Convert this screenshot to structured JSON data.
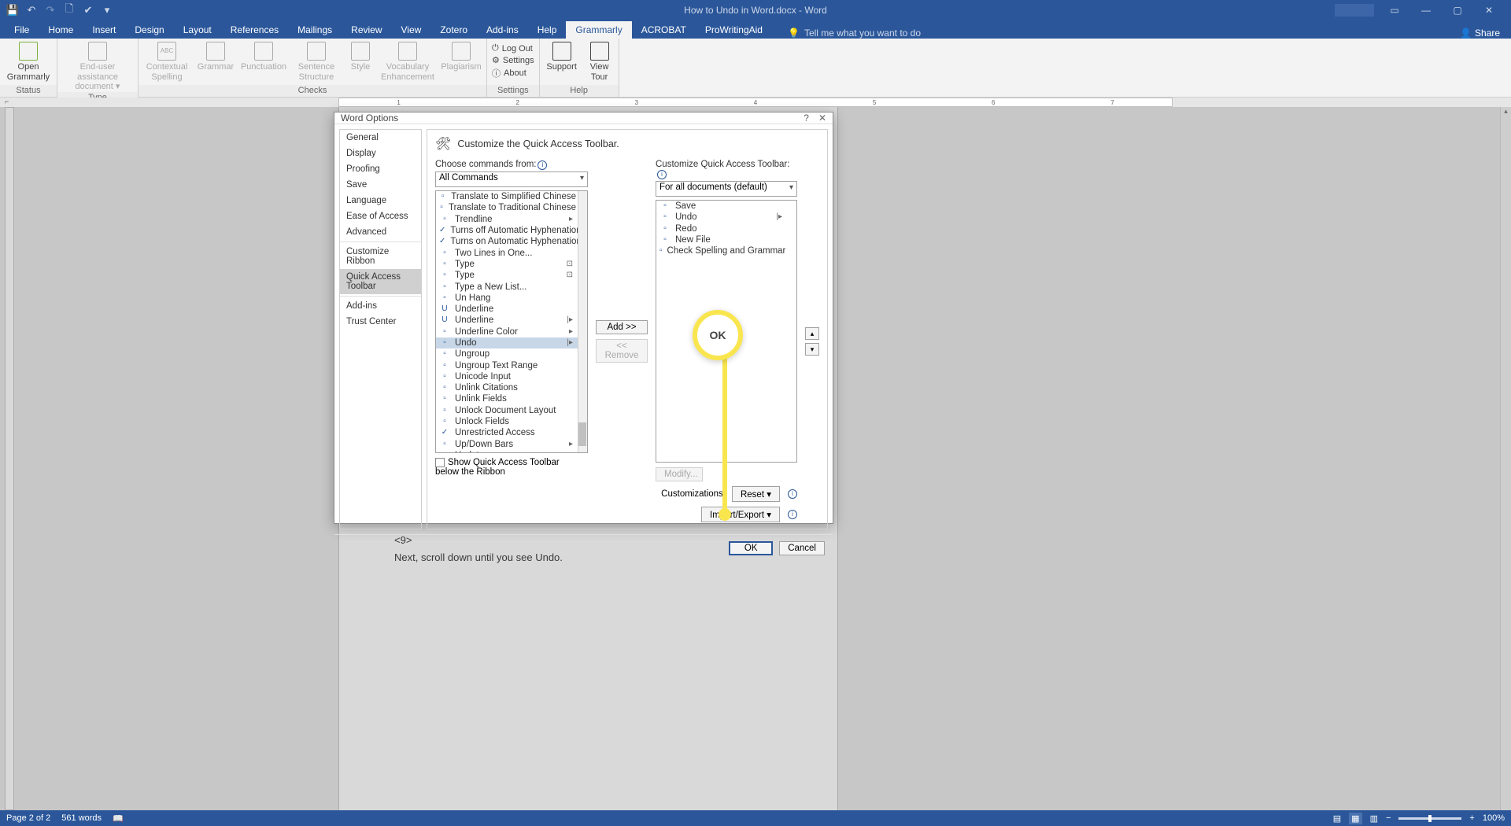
{
  "title": "How to Undo in Word.docx - Word",
  "qat_icons": [
    "save-icon",
    "undo-icon",
    "redo-icon",
    "newfile-icon",
    "spellcheck-icon",
    "customize-qat-icon"
  ],
  "window": {
    "min": "—",
    "max": "▢",
    "close": "✕",
    "ribbon": "▭",
    "account": "▭"
  },
  "tabs": [
    "File",
    "Home",
    "Insert",
    "Design",
    "Layout",
    "References",
    "Mailings",
    "Review",
    "View",
    "Zotero",
    "Add-ins",
    "Help",
    "Grammarly",
    "ACROBAT",
    "ProWritingAid"
  ],
  "active_tab": "Grammarly",
  "tell_me": "Tell me what you want to do",
  "share": "Share",
  "ribbon": {
    "groups": [
      {
        "label": "Status",
        "buttons": [
          {
            "label": "Open\nGrammarly",
            "id": "open-grammarly"
          }
        ]
      },
      {
        "label": "Type",
        "buttons": [
          {
            "label": "End-user assistance\ndocument ▾",
            "id": "doc-type",
            "disabled": true
          }
        ]
      },
      {
        "label": "Checks",
        "buttons": [
          {
            "label": "Contextual\nSpelling",
            "id": "contextual-spelling",
            "disabled": true
          },
          {
            "label": "Grammar",
            "id": "grammar",
            "disabled": true
          },
          {
            "label": "Punctuation",
            "id": "punctuation",
            "disabled": true
          },
          {
            "label": "Sentence\nStructure",
            "id": "sentence-structure",
            "disabled": true
          },
          {
            "label": "Style",
            "id": "style",
            "disabled": true
          },
          {
            "label": "Vocabulary\nEnhancement",
            "id": "vocab",
            "disabled": true
          },
          {
            "label": "Plagiarism",
            "id": "plagiarism",
            "disabled": true
          }
        ]
      },
      {
        "label": "Settings",
        "links": [
          {
            "label": "Log Out",
            "id": "logout"
          },
          {
            "label": "Settings",
            "id": "settings"
          },
          {
            "label": "About",
            "id": "about"
          }
        ]
      },
      {
        "label": "Help",
        "buttons": [
          {
            "label": "Support",
            "id": "support"
          },
          {
            "label": "View\nTour",
            "id": "view-tour"
          }
        ]
      }
    ]
  },
  "document": {
    "marker": "<9>",
    "text": "Next, scroll down until you see Undo."
  },
  "dialog": {
    "title": "Word Options",
    "help": "?",
    "close": "✕",
    "sidebar": [
      "General",
      "Display",
      "Proofing",
      "Save",
      "Language",
      "Ease of Access",
      "Advanced",
      "—",
      "Customize Ribbon",
      "Quick Access Toolbar",
      "—",
      "Add-ins",
      "Trust Center"
    ],
    "sidebar_selected": "Quick Access Toolbar",
    "heading": "Customize the Quick Access Toolbar.",
    "choose_label": "Choose commands from:",
    "choose_value": "All Commands",
    "customize_label": "Customize Quick Access Toolbar:",
    "customize_value": "For all documents (default)",
    "left_list": [
      {
        "t": "Translate to Simplified Chinese"
      },
      {
        "t": "Translate to Traditional Chinese"
      },
      {
        "t": "Trendline",
        "sub": "▸"
      },
      {
        "t": "Turns off Automatic Hyphenation",
        "chk": true
      },
      {
        "t": "Turns on Automatic Hyphenation",
        "chk": true
      },
      {
        "t": "Two Lines in One..."
      },
      {
        "t": "Type",
        "sub": "⊡"
      },
      {
        "t": "Type",
        "sub": "⊡"
      },
      {
        "t": "Type a New List..."
      },
      {
        "t": "Un Hang"
      },
      {
        "t": "Underline",
        "u": true
      },
      {
        "t": "Underline",
        "u": true,
        "sub": "|▸"
      },
      {
        "t": "Underline Color",
        "sub": "▸"
      },
      {
        "t": "Undo",
        "sel": true,
        "sub": "|▸"
      },
      {
        "t": "Ungroup"
      },
      {
        "t": "Ungroup Text Range"
      },
      {
        "t": "Unicode Input"
      },
      {
        "t": "Unlink Citations"
      },
      {
        "t": "Unlink Fields"
      },
      {
        "t": "Unlock Document Layout"
      },
      {
        "t": "Unlock Fields"
      },
      {
        "t": "Unrestricted Access",
        "chk": true
      },
      {
        "t": "Up/Down Bars",
        "sub": "▸"
      },
      {
        "t": "Update"
      }
    ],
    "right_list": [
      {
        "t": "Save"
      },
      {
        "t": "Undo",
        "sub": "|▸"
      },
      {
        "t": "Redo"
      },
      {
        "t": "New File"
      },
      {
        "t": "Check Spelling and Grammar"
      }
    ],
    "add": "Add >>",
    "remove": "<< Remove",
    "modify": "Modify...",
    "show_below": "Show Quick Access Toolbar below the Ribbon",
    "customizations": "Customizations:",
    "reset": "Reset ▾",
    "import_export": "Import/Export ▾",
    "ok": "OK",
    "cancel": "Cancel",
    "up": "▴",
    "down": "▾"
  },
  "highlight": {
    "label": "OK"
  },
  "status": {
    "page": "Page 2 of 2",
    "words": "561 words",
    "zoom": "100%",
    "minus": "−",
    "plus": "+"
  }
}
